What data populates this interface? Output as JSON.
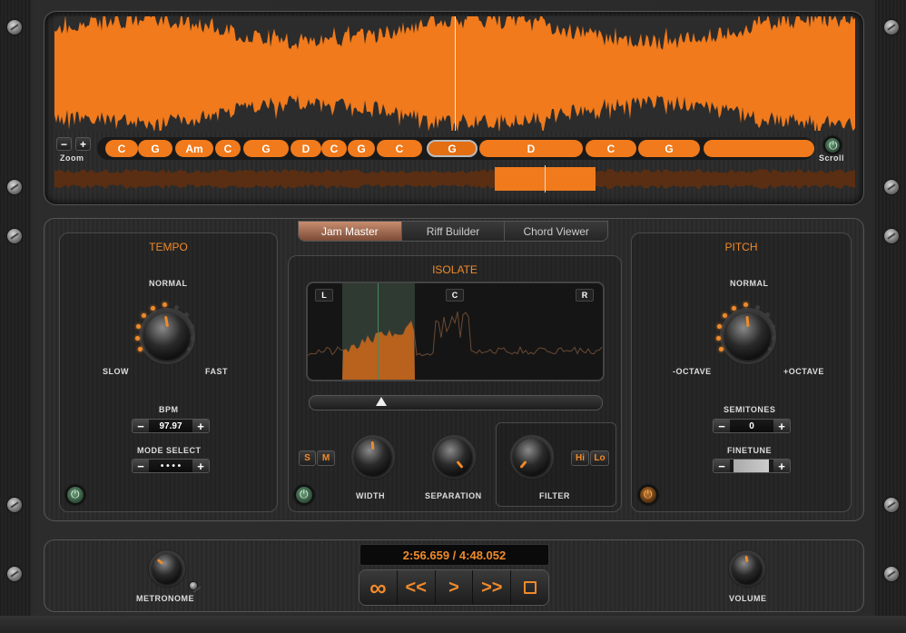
{
  "colors": {
    "accent": "#f08a2a",
    "wave": "#f07a1c",
    "panel_bg": "#2a2a2a",
    "active_tab": "#a0634a"
  },
  "waveform": {
    "zoom_label": "Zoom",
    "scroll_label": "Scroll",
    "zoom_minus": "−",
    "zoom_plus": "+",
    "chords": [
      "C",
      "G",
      "Am",
      "C",
      "G",
      "D",
      "C",
      "G",
      "C",
      "G",
      "D",
      "C",
      "G",
      ""
    ],
    "selected_chord_index": 9
  },
  "tabs": [
    {
      "label": "Jam Master",
      "active": true
    },
    {
      "label": "Riff Builder",
      "active": false
    },
    {
      "label": "Chord Viewer",
      "active": false
    }
  ],
  "tempo": {
    "title": "TEMPO",
    "normal_label": "NORMAL",
    "slow_label": "SLOW",
    "fast_label": "FAST",
    "bpm_label": "BPM",
    "bpm_value": "97.97",
    "mode_label": "MODE SELECT",
    "mode_value": "• • • •",
    "minus": "−",
    "plus": "+"
  },
  "isolate": {
    "title": "ISOLATE",
    "tag_left": "L",
    "tag_center": "C",
    "tag_right": "R",
    "s_label": "S",
    "m_label": "M",
    "width_label": "WIDTH",
    "separation_label": "SEPARATION",
    "filter_label": "FILTER",
    "hi_label": "Hi",
    "lo_label": "Lo"
  },
  "pitch": {
    "title": "PITCH",
    "normal_label": "NORMAL",
    "minus_octave_label": "-OCTAVE",
    "plus_octave_label": "+OCTAVE",
    "semitones_label": "SEMITONES",
    "semitones_value": "0",
    "finetune_label": "FINETUNE",
    "minus": "−",
    "plus": "+"
  },
  "transport": {
    "time": "2:56.659 / 4:48.052",
    "loop_icon": "∞",
    "rewind_label": "<<",
    "play_label": ">",
    "forward_label": ">>",
    "metronome_label": "METRONOME",
    "volume_label": "VOLUME"
  }
}
